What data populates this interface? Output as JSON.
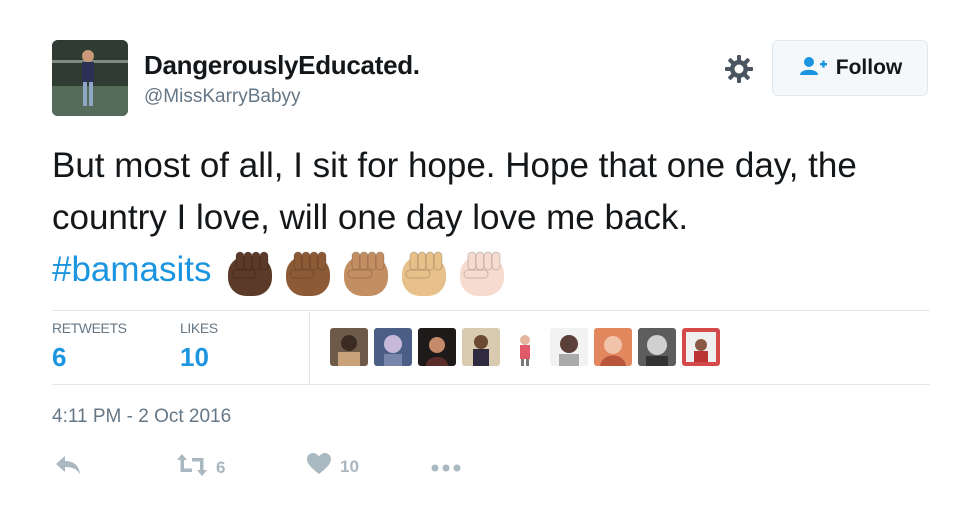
{
  "tweet": {
    "display_name": "DangerouslyEducated.",
    "handle": "@MissKarryBabyy",
    "follow_label": "Follow",
    "text": "But most of all, I sit for hope. Hope that one day, the country I love, will one day love me back.",
    "hashtag": "#bamasits",
    "emoji": [
      "raised-fist-dark",
      "raised-fist-medium-dark",
      "raised-fist-medium",
      "raised-fist-medium-light",
      "raised-fist-light"
    ],
    "timestamp": "4:11 PM - 2 Oct 2016"
  },
  "stats": {
    "retweets_label": "RETWEETS",
    "retweets": "6",
    "likes_label": "LIKES",
    "likes": "10"
  },
  "actions": {
    "reply_icon": "reply-icon",
    "retweet_icon": "retweet-icon",
    "retweet_count": "6",
    "like_icon": "heart-icon",
    "like_count": "10",
    "more_icon": "more-icon"
  },
  "colors": {
    "link": "#1b95e0",
    "muted": "#657786",
    "action": "#aab8c2",
    "border": "#e1e8ed"
  }
}
